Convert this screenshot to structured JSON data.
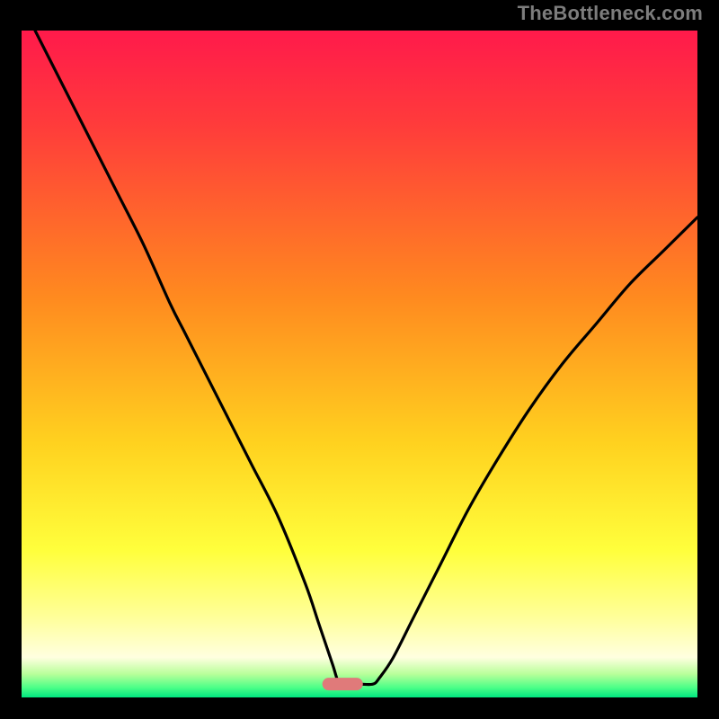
{
  "watermark": "TheBottleneck.com",
  "chart_data": {
    "type": "line",
    "title": "",
    "xlabel": "",
    "ylabel": "",
    "xlim": [
      0,
      100
    ],
    "ylim": [
      0,
      100
    ],
    "gradient_stops": [
      {
        "offset": 0.0,
        "color": "#ff1a4b"
      },
      {
        "offset": 0.14,
        "color": "#ff3b3b"
      },
      {
        "offset": 0.4,
        "color": "#ff8a1f"
      },
      {
        "offset": 0.62,
        "color": "#ffd21f"
      },
      {
        "offset": 0.78,
        "color": "#ffff3c"
      },
      {
        "offset": 0.88,
        "color": "#ffff9a"
      },
      {
        "offset": 0.94,
        "color": "#ffffe0"
      },
      {
        "offset": 0.965,
        "color": "#b8ff9a"
      },
      {
        "offset": 0.985,
        "color": "#4dff88"
      },
      {
        "offset": 1.0,
        "color": "#00e680"
      }
    ],
    "marker": {
      "x": 47.5,
      "y": 2,
      "width": 6,
      "height": 2,
      "color": "#e07a7a"
    },
    "series": [
      {
        "name": "curve",
        "x": [
          2,
          6,
          10,
          14,
          18,
          22,
          24,
          26,
          30,
          34,
          38,
          42,
          44,
          46,
          47,
          48,
          50,
          52,
          53,
          55,
          58,
          62,
          66,
          70,
          75,
          80,
          85,
          90,
          95,
          100
        ],
        "values": [
          100,
          92,
          84,
          76,
          68,
          59,
          55,
          51,
          43,
          35,
          27,
          17,
          11,
          5,
          2,
          2,
          2,
          2,
          3,
          6,
          12,
          20,
          28,
          35,
          43,
          50,
          56,
          62,
          67,
          72
        ]
      }
    ]
  }
}
